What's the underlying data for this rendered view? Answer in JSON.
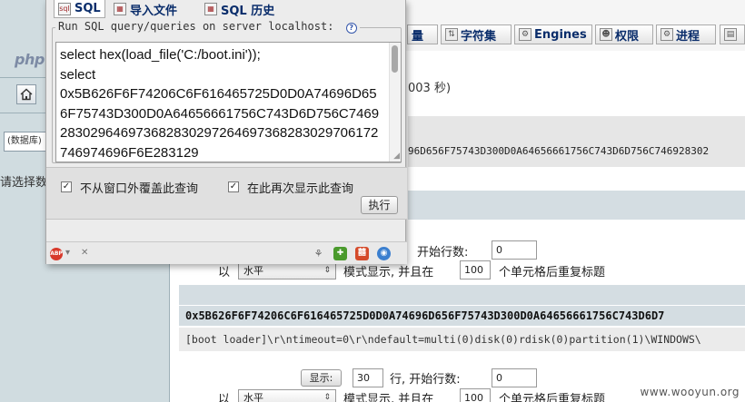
{
  "left_frame": {
    "logo_text": "php",
    "db_select_value": "(数据库)",
    "hint_text": "请选择数"
  },
  "top_tabs": [
    {
      "label": "量",
      "icon": "status-icon"
    },
    {
      "label": "字符集",
      "icon": "charset-icon"
    },
    {
      "label": "Engines",
      "icon": "engines-icon"
    },
    {
      "label": "权限",
      "icon": "privileges-icon"
    },
    {
      "label": "进程",
      "icon": "processes-icon"
    },
    {
      "label": "",
      "icon": "more-icon"
    }
  ],
  "query_info": {
    "time_text": "003 秒)",
    "sql_fragment": "96D656F75743D300D0A64656661756C743D6D756C746928302"
  },
  "display_controls": {
    "start_row_label": "开始行数:",
    "start_row_value": "0",
    "with_label": "以",
    "mode_value": "水平",
    "mode_suffix": "模式显示, 并且在",
    "repeat_value": "100",
    "repeat_suffix": "个单元格后重复标题"
  },
  "result": {
    "hex_value": "0x5B626F6F74206C6F616465725D0D0A74696D656F75743D300D0A64656661756C743D6D7",
    "boot_text": "[boot loader]\\r\\ntimeout=0\\r\\ndefault=multi(0)disk(0)rdisk(0)partition(1)\\WINDOWS\\"
  },
  "bottom_controls": {
    "show_button": "显示:",
    "rows_value": "30",
    "rows_suffix": "行, 开始行数:",
    "start_value": "0",
    "with_label": "以",
    "mode_value": "水平",
    "mode_suffix": "模式显示, 并且在",
    "repeat_value": "100",
    "repeat_suffix": "个单元格后重复标题"
  },
  "popup": {
    "tabs": [
      {
        "label": "SQL",
        "icon": "sql-icon",
        "active": true
      },
      {
        "label": "导入文件",
        "icon": "import-icon",
        "active": false
      },
      {
        "label": "SQL 历史",
        "icon": "history-icon",
        "active": false
      }
    ],
    "legend": "Run SQL query/queries on server localhost:",
    "query_text": "select hex(load_file('C:/boot.ini'));\nselect\n0x5B626F6F74206C6F616465725D0D0A74696D656F75743D300D0A64656661756C743D6D756C7469283029646973682830297264697368283029706172746974696F6E283129",
    "option_1": "不从窗口外覆盖此查询",
    "option_1_checked": true,
    "option_2": "在此再次显示此查询",
    "option_2_checked": true,
    "go_button": "执行",
    "status_abp": "ABP"
  },
  "watermark": "www.wooyun.org"
}
